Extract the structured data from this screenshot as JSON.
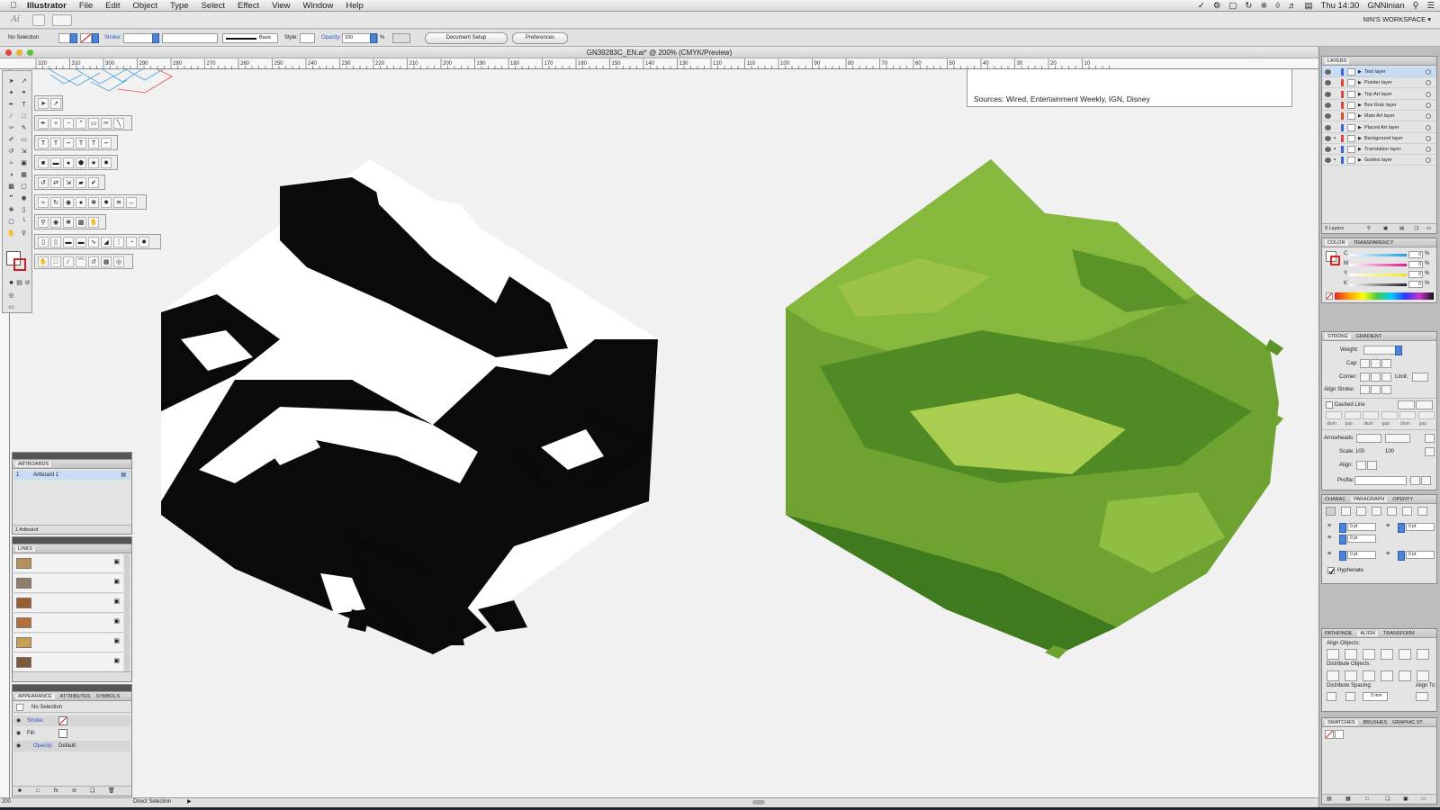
{
  "menubar": {
    "app_name": "Illustrator",
    "items": [
      "File",
      "Edit",
      "Object",
      "Type",
      "Select",
      "Effect",
      "View",
      "Window",
      "Help"
    ],
    "clock": "Thu 14:30",
    "user": "GNNinian"
  },
  "appbar": {
    "workspace": "NIN'S WORKSPACE ▾"
  },
  "control": {
    "selection": "No Selection",
    "stroke_label": "Stroke:",
    "stroke_profile": "Basic",
    "style_label": "Style:",
    "opacity_label": "Opacity:",
    "opacity_value": "100",
    "opacity_unit": "%",
    "doc_setup": "Document Setup",
    "preferences": "Preferences"
  },
  "document": {
    "title": "GN39283C_EN.ai* @ 200% (CMYK/Preview)",
    "sources_text": "Sources: Wired, Entertainment Weekly, IGN, Disney",
    "ruler_marks": [
      "320",
      "310",
      "300",
      "290",
      "280",
      "270",
      "260",
      "250",
      "240",
      "230",
      "220",
      "210",
      "200",
      "190",
      "180",
      "170",
      "160",
      "150",
      "140",
      "130",
      "120",
      "110",
      "100",
      "90",
      "80",
      "70",
      "60",
      "50",
      "40",
      "30",
      "20",
      "10"
    ],
    "status": "Direct Selection"
  },
  "artboards": {
    "tab": "ARTBOARDS",
    "rows": [
      {
        "num": "1",
        "name": "Artboard 1"
      }
    ],
    "footer": "1 Artboard"
  },
  "links": {
    "tab": "LINKS"
  },
  "appearance": {
    "tabs": [
      "APPEARANCE",
      "ATTRIBUTES",
      "SYMBOLS"
    ],
    "title": "No Selection",
    "stroke": "Stroke:",
    "fill": "Fill:",
    "opacity": "Opacity:",
    "opacity_value": "Default"
  },
  "layers": {
    "tab": "LAYERS",
    "items": [
      {
        "name": "Text layer",
        "color": "#3b64d8"
      },
      {
        "name": "Pointer layer",
        "color": "#d84a3b"
      },
      {
        "name": "Top Art layer",
        "color": "#d84a3b"
      },
      {
        "name": "Box Rule layer",
        "color": "#d84a3b"
      },
      {
        "name": "Main Art layer",
        "color": "#d84a3b"
      },
      {
        "name": "Placed Art layer",
        "color": "#3b64d8"
      },
      {
        "name": "Background layer",
        "color": "#d84a3b"
      },
      {
        "name": "Translation layer",
        "color": "#3b64d8"
      },
      {
        "name": "Guides layer",
        "color": "#3b64d8"
      }
    ],
    "footer": "9 Layers"
  },
  "color": {
    "tabs": [
      "COLOR",
      "TRANSPARENCY"
    ],
    "channels": [
      {
        "label": "C",
        "value": "0",
        "unit": "%",
        "color": "#16a0e8"
      },
      {
        "label": "M",
        "value": "0",
        "unit": "%",
        "color": "#e8168c"
      },
      {
        "label": "Y",
        "value": "0",
        "unit": "%",
        "color": "#f2e511"
      },
      {
        "label": "K",
        "value": "0",
        "unit": "%",
        "color": "#222222"
      }
    ]
  },
  "stroke": {
    "tabs": [
      "STROKE",
      "GRADIENT"
    ],
    "weight": "Weight:",
    "cap": "Cap:",
    "corner": "Corner:",
    "limit": "Limit:",
    "align_stroke": "Align Stroke:",
    "dashed_line": "Dashed Line",
    "dash_labels": [
      "dash",
      "gap",
      "dash",
      "gap",
      "dash",
      "gap"
    ],
    "arrowheads": "Arrowheads:",
    "scale": "Scale:",
    "scale_a": "100",
    "scale_b": "100",
    "align": "Align:",
    "profile": "Profile:"
  },
  "paragraph": {
    "tabs": [
      "CHARAC",
      "PARAGRAPH",
      "OPENTY"
    ],
    "fields": [
      "0 pt",
      "0 pt",
      "0 pt",
      "0 pt",
      "0 pt"
    ],
    "hyphenate": "Hyphenate"
  },
  "align": {
    "tabs": [
      "PATHFINDE",
      "ALIGN",
      "TRANSFORM"
    ],
    "align_objects": "Align Objects:",
    "distribute_objects": "Distribute Objects:",
    "distribute_spacing": "Distribute Spacing:",
    "align_to": "Align To:",
    "spacing_value": "0 mm"
  },
  "swatches": {
    "tabs": [
      "SWATCHES",
      "BRUSHES",
      "GRAPHIC ST"
    ]
  },
  "colors": {
    "green_dark": "#3f7a1e",
    "green_mid": "#6ea332",
    "green_light": "#a9cd4e",
    "selection_blue": "#c9dcf5"
  }
}
